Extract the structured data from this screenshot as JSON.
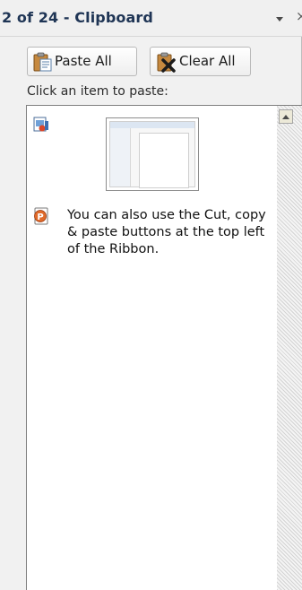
{
  "header": {
    "title": "2 of 24 - Clipboard",
    "dropdown_icon": "triangle-down-icon",
    "close_label": "×"
  },
  "toolbar": {
    "paste_all_label": "Paste All",
    "clear_all_label": "Clear All",
    "paste_icon": "clipboard-paste-icon",
    "clear_icon": "clear-x-icon"
  },
  "hint": "Click an item to paste:",
  "items": [
    {
      "type": "image",
      "icon": "picture-item-icon",
      "thumbnail": "slide-screenshot-thumbnail"
    },
    {
      "type": "text",
      "icon": "powerpoint-item-icon",
      "text": "You can also use the Cut, copy & paste buttons at the top left of the Ribbon."
    }
  ],
  "colors": {
    "title": "#1f3555",
    "pane_background": "#f1f1f1",
    "list_background": "#ffffff"
  }
}
